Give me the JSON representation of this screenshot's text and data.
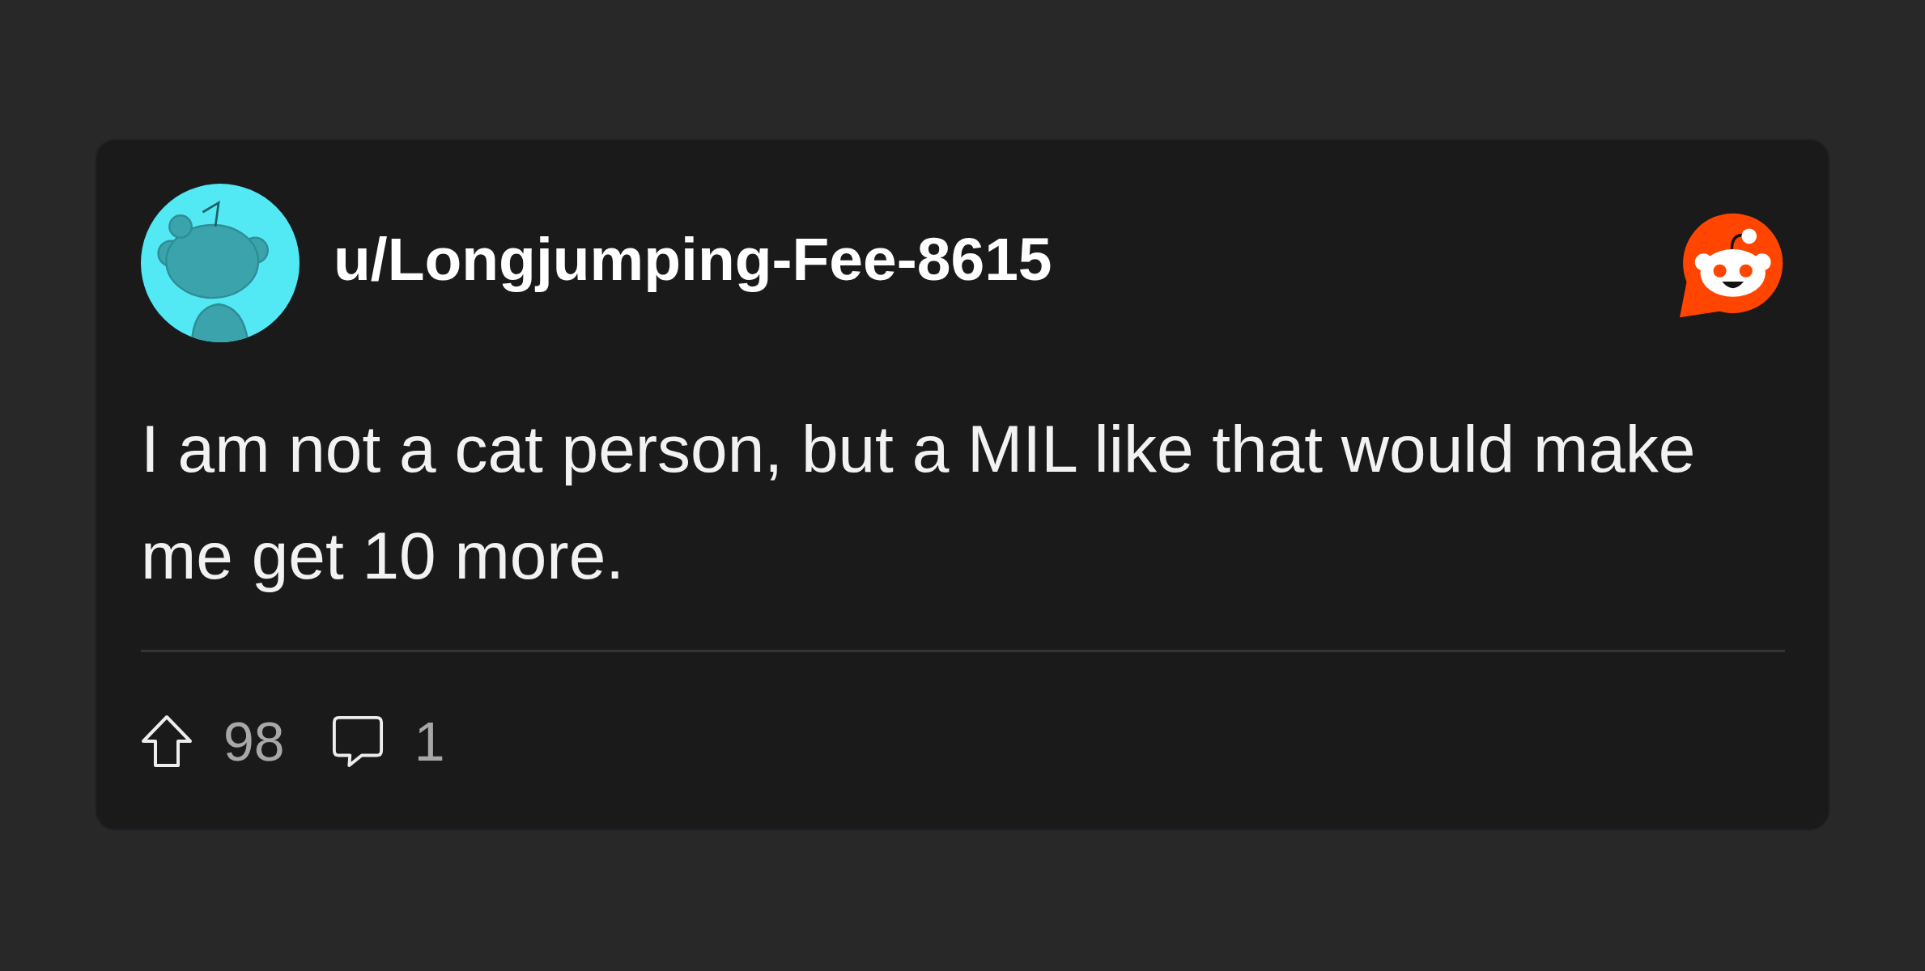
{
  "post": {
    "author": {
      "username": "u/Longjumping-Fee-8615"
    },
    "body": "I am not a cat person, but a MIL like that would make me get 10 more.",
    "stats": [
      {
        "kind": "upvotes",
        "count": "98"
      },
      {
        "kind": "comments",
        "count": "1"
      }
    ]
  }
}
